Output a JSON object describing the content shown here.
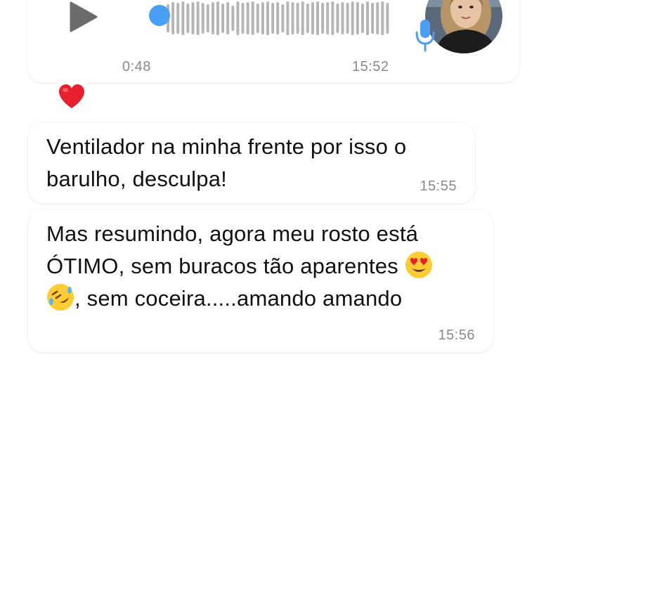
{
  "voice_message": {
    "duration": "0:48",
    "time": "15:52",
    "progress": 0.0,
    "avatar_icon": "contact-photo",
    "mic_icon": "microphone-icon",
    "play_icon": "play-icon",
    "accent_color": "#4a9ff5"
  },
  "reaction": {
    "emoji": "❤️",
    "icon": "heart-icon"
  },
  "messages": [
    {
      "lines": [
        "Ventilador na minha frente por isso o",
        "barulho, desculpa!"
      ],
      "time": "15:55"
    },
    {
      "line1": "Mas resumindo, agora meu rosto está",
      "line2": "ÓTIMO, sem buracos tão aparentes",
      "line3": ", sem coceira.....amando amando",
      "emoji_heart_eyes": "😍",
      "emoji_rofl": "🤣",
      "time": "15:56"
    }
  ]
}
